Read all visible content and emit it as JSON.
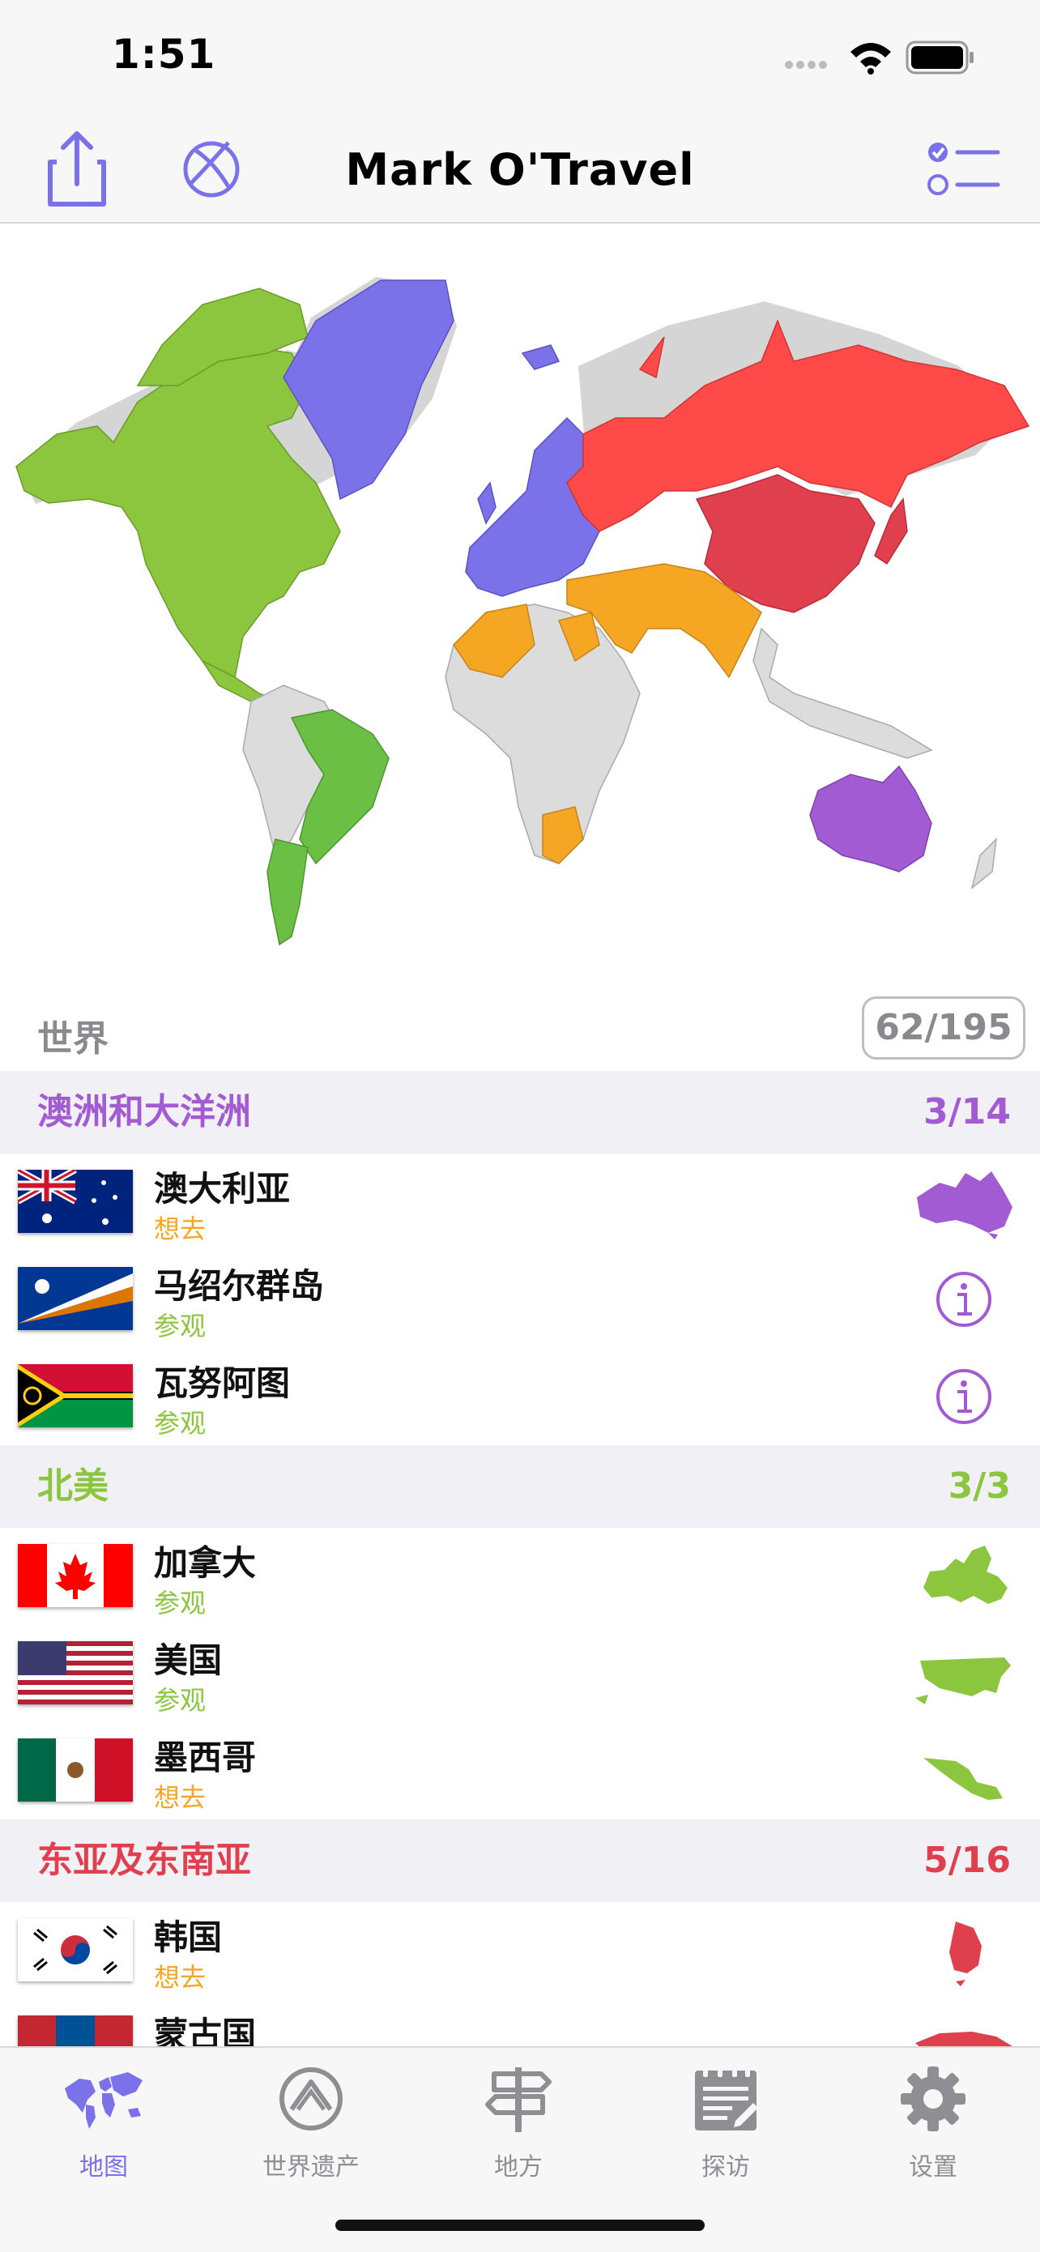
{
  "status_bar": {
    "time": "1:51"
  },
  "nav": {
    "title": "Mark O'Travel"
  },
  "world": {
    "label": "世界",
    "count": "62/195"
  },
  "sections": [
    {
      "title": "澳洲和大洋洲",
      "count": "3/14",
      "color": "#a35bd3",
      "rows": [
        {
          "name": "澳大利亚",
          "status": "想去",
          "status_color": "#f5a623",
          "icon": "australia-shape-icon"
        },
        {
          "name": "马绍尔群岛",
          "status": "参观",
          "status_color": "#8cc63f",
          "icon": "info-icon"
        },
        {
          "name": "瓦努阿图",
          "status": "参观",
          "status_color": "#8cc63f",
          "icon": "info-icon"
        }
      ]
    },
    {
      "title": "北美",
      "count": "3/3",
      "color": "#8cc63f",
      "rows": [
        {
          "name": "加拿大",
          "status": "参观",
          "status_color": "#8cc63f",
          "icon": "canada-shape-icon"
        },
        {
          "name": "美国",
          "status": "参观",
          "status_color": "#8cc63f",
          "icon": "usa-shape-icon"
        },
        {
          "name": "墨西哥",
          "status": "想去",
          "status_color": "#f5a623",
          "icon": "mexico-shape-icon"
        }
      ]
    },
    {
      "title": "东亚及东南亚",
      "count": "5/16",
      "color": "#e0404d",
      "rows": [
        {
          "name": "韩国",
          "status": "想去",
          "status_color": "#f5a623",
          "icon": "korea-shape-icon"
        },
        {
          "name": "蒙古国",
          "status": "",
          "status_color": "#f5a623",
          "icon": "mongolia-shape-icon"
        }
      ]
    }
  ],
  "tabs": [
    {
      "label": "地图",
      "icon": "world-map-icon",
      "active": true
    },
    {
      "label": "世界遗产",
      "icon": "heritage-icon",
      "active": false
    },
    {
      "label": "地方",
      "icon": "signpost-icon",
      "active": false
    },
    {
      "label": "探访",
      "icon": "journal-icon",
      "active": false
    },
    {
      "label": "设置",
      "icon": "gear-icon",
      "active": false
    }
  ],
  "colors": {
    "accent": "#7b72e9",
    "oceania": "#a35bd3",
    "north_america": "#8cc63f",
    "south_america": "#6cbf45",
    "europe": "#7b72e9",
    "russia": "#ff4a4a",
    "east_asia": "#e0404d",
    "middle_east": "#f5a623",
    "unvisited": "#dcdcdc",
    "tab_inactive": "#8e8e93"
  }
}
